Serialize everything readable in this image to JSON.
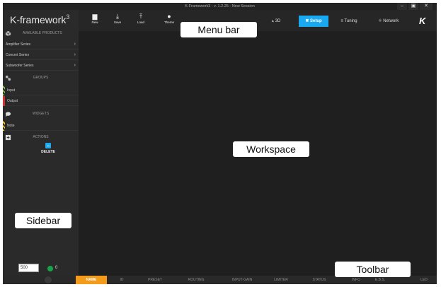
{
  "window": {
    "title": "K-Framework3 - v. 1.2.25 - New Session",
    "controls": [
      "–",
      "▣",
      "✕"
    ]
  },
  "logo": {
    "text": "K-framework",
    "sup": "3"
  },
  "sidebar": {
    "products_heading": "AVAILABLE PRODUCTS",
    "products": [
      {
        "label": "Amplifier Series"
      },
      {
        "label": "Concert Series"
      },
      {
        "label": "Subwoofer Series"
      }
    ],
    "groups_heading": "GROUPS",
    "groups": [
      {
        "label": "Input",
        "color": "#8bc34a"
      },
      {
        "label": "Output",
        "color": "#d32f2f"
      }
    ],
    "widgets_heading": "WIDGETS",
    "widgets": [
      {
        "label": "Note"
      }
    ],
    "actions_heading": "ACTIONS",
    "delete_label": "DELETE",
    "count_input_value": "500",
    "status_count": "0"
  },
  "toolbar_top": {
    "buttons": [
      {
        "label": "New",
        "icon": "file-icon"
      },
      {
        "label": "Save",
        "icon": "download-icon"
      },
      {
        "label": "Load",
        "icon": "upload-icon"
      },
      {
        "label": "Theme",
        "icon": "bulb-icon"
      }
    ],
    "nav": [
      {
        "label": "3D",
        "glyph": "⩓",
        "active": false
      },
      {
        "label": "Setup",
        "glyph": "✖",
        "active": true
      },
      {
        "label": "Tuning",
        "glyph": "≡",
        "active": false
      },
      {
        "label": "Network",
        "glyph": "⛗",
        "active": false
      }
    ],
    "brand": "K"
  },
  "bottom_toolbar": {
    "columns": [
      {
        "label": "NAME",
        "active": true
      },
      {
        "label": "ID",
        "active": false
      },
      {
        "label": "PRESET",
        "active": false
      },
      {
        "label": "ROUTING",
        "active": false
      },
      {
        "label": "INPUT-GAIN",
        "active": false
      },
      {
        "label": "LIMITER",
        "active": false
      },
      {
        "label": "STATUS",
        "active": false
      },
      {
        "label": "INFO",
        "active": false
      },
      {
        "label": "E.B.S.",
        "active": false
      },
      {
        "label": "LED",
        "active": false
      }
    ]
  },
  "callouts": {
    "menu_bar": "Menu bar",
    "workspace": "Workspace",
    "sidebar": "Sidebar",
    "toolbar": "Toolbar"
  },
  "colors": {
    "accent": "#1aa8f0",
    "active_column": "#f59b1c",
    "status_ok": "#17a34a"
  }
}
